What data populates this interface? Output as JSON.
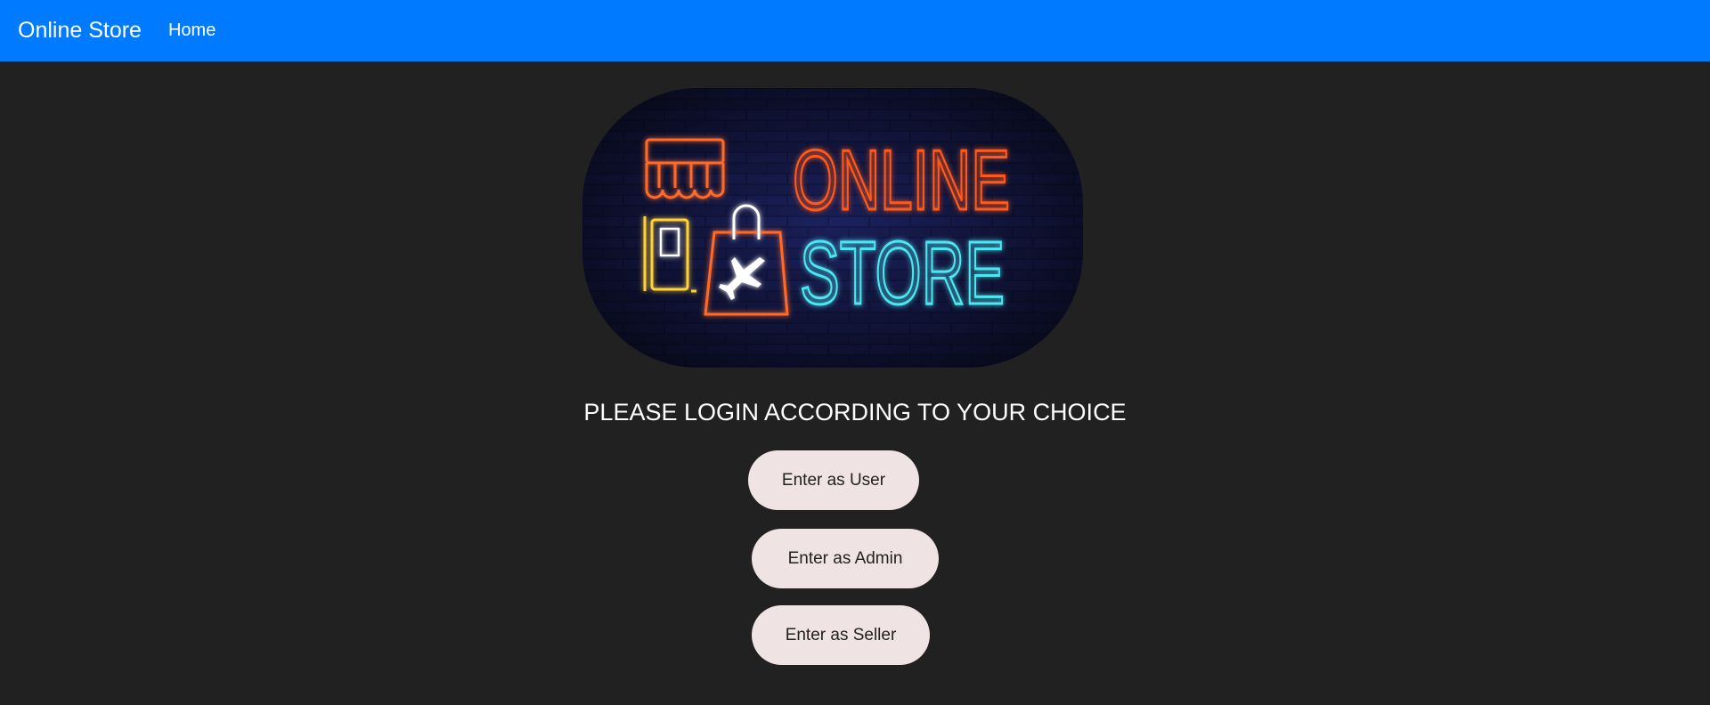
{
  "navbar": {
    "brand": "Online Store",
    "links": [
      {
        "label": "Home"
      }
    ],
    "background": "#007bff"
  },
  "banner": {
    "line1": "ONLINE",
    "line2": "STORE",
    "icons": [
      "store-awning-icon",
      "phone-icon",
      "shopping-bag-icon",
      "airplane-icon"
    ],
    "colors": {
      "online": "#ff5a1f",
      "store": "#4ee6f2",
      "phone": "#ffd23a",
      "bag": "#ff6a2a",
      "bricks": "#141a4a"
    }
  },
  "main": {
    "prompt": "PLEASE LOGIN ACCORDING TO YOUR CHOICE",
    "buttons": {
      "user": "Enter as User",
      "admin": "Enter as Admin",
      "seller": "Enter as Seller"
    }
  },
  "theme": {
    "page_background": "#212121",
    "button_background": "#efe3e3"
  }
}
